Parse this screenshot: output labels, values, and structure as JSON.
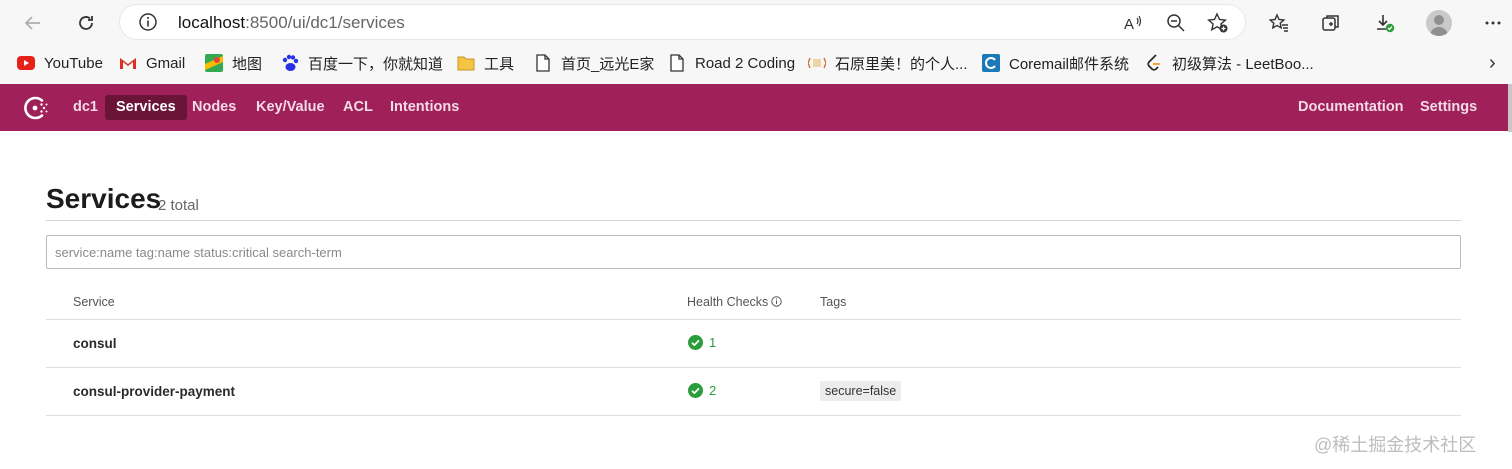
{
  "browser": {
    "url_host": "localhost",
    "url_rest": ":8500/ui/dc1/services",
    "bookmarks": [
      {
        "label": "YouTube",
        "icon": "youtube-icon"
      },
      {
        "label": "Gmail",
        "icon": "gmail-icon"
      },
      {
        "label": "地图",
        "icon": "maps-icon"
      },
      {
        "label": "百度一下，你就知道",
        "icon": "baidu-icon"
      },
      {
        "label": "工具",
        "icon": "folder-icon"
      },
      {
        "label": "首页_远光E家",
        "icon": "page-icon"
      },
      {
        "label": "Road 2 Coding",
        "icon": "page-icon"
      },
      {
        "label": "石原里美！的个人...",
        "icon": "site-icon"
      },
      {
        "label": "Coremail邮件系统",
        "icon": "coremail-icon"
      },
      {
        "label": "初级算法 - LeetBoo...",
        "icon": "leetcode-icon"
      }
    ]
  },
  "nav": {
    "datacenter": "dc1",
    "items": [
      "Services",
      "Nodes",
      "Key/Value",
      "ACL",
      "Intentions"
    ],
    "active": "Services",
    "right": [
      "Documentation",
      "Settings"
    ]
  },
  "page": {
    "title": "Services",
    "total": "2 total",
    "search_placeholder": "service:name tag:name status:critical search-term"
  },
  "table": {
    "headers": {
      "service": "Service",
      "health": "Health Checks",
      "tags": "Tags"
    },
    "rows": [
      {
        "service": "consul",
        "checks": "1",
        "tags": []
      },
      {
        "service": "consul-provider-payment",
        "checks": "2",
        "tags": [
          "secure=false"
        ]
      }
    ]
  },
  "watermark": "@稀土掘金技术社区",
  "colors": {
    "brand": "#a0205a",
    "brand_active": "#6a1538",
    "passing": "#2a9d3a"
  }
}
